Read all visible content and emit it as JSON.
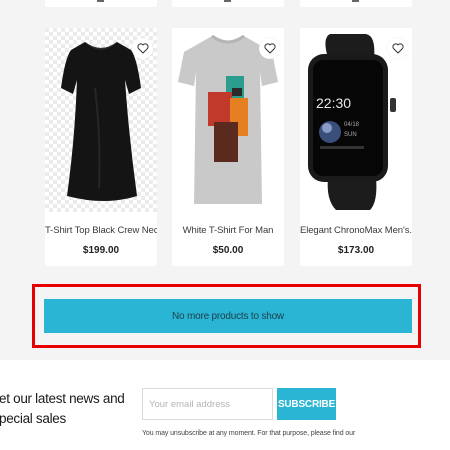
{
  "products": [
    {
      "name": "T-Shirt Top Black Crew Neck...",
      "price": "$199.00",
      "icon": "heart-outline-icon"
    },
    {
      "name": "White T-Shirt For Man",
      "price": "$50.00",
      "icon": "heart-outline-icon"
    },
    {
      "name": "Elegant ChronoMax Men's...",
      "price": "$173.00",
      "icon": "heart-outline-icon"
    }
  ],
  "watch_screen": {
    "time": "22:30",
    "date": "04/18",
    "day": "SUN"
  },
  "load_more": {
    "label": "No more products to show"
  },
  "newsletter": {
    "title_line1": "et our latest news and",
    "title_line2": "pecial sales",
    "email_placeholder": "Your email address",
    "subscribe_label": "SUBSCRIBE",
    "legal_text": "You may unsubscribe at any moment. For that purpose, please find our"
  },
  "colors": {
    "accent": "#2ab5d4",
    "highlight": "#e60000",
    "page_bg": "#f4f4f4"
  }
}
